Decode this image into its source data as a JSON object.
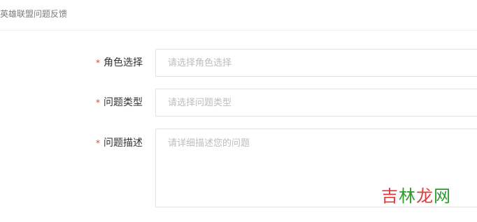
{
  "header": {
    "title": "英雄联盟问题反馈"
  },
  "form": {
    "required_mark": "*",
    "role": {
      "label": "角色选择",
      "placeholder": "请选择角色选择"
    },
    "type": {
      "label": "问题类型",
      "placeholder": "请选择问题类型"
    },
    "description": {
      "label": "问题描述",
      "placeholder": "请详细描述您的问题"
    }
  },
  "watermark": {
    "part1": "吉",
    "part2": "林",
    "part3": "龙",
    "part4": "网"
  }
}
